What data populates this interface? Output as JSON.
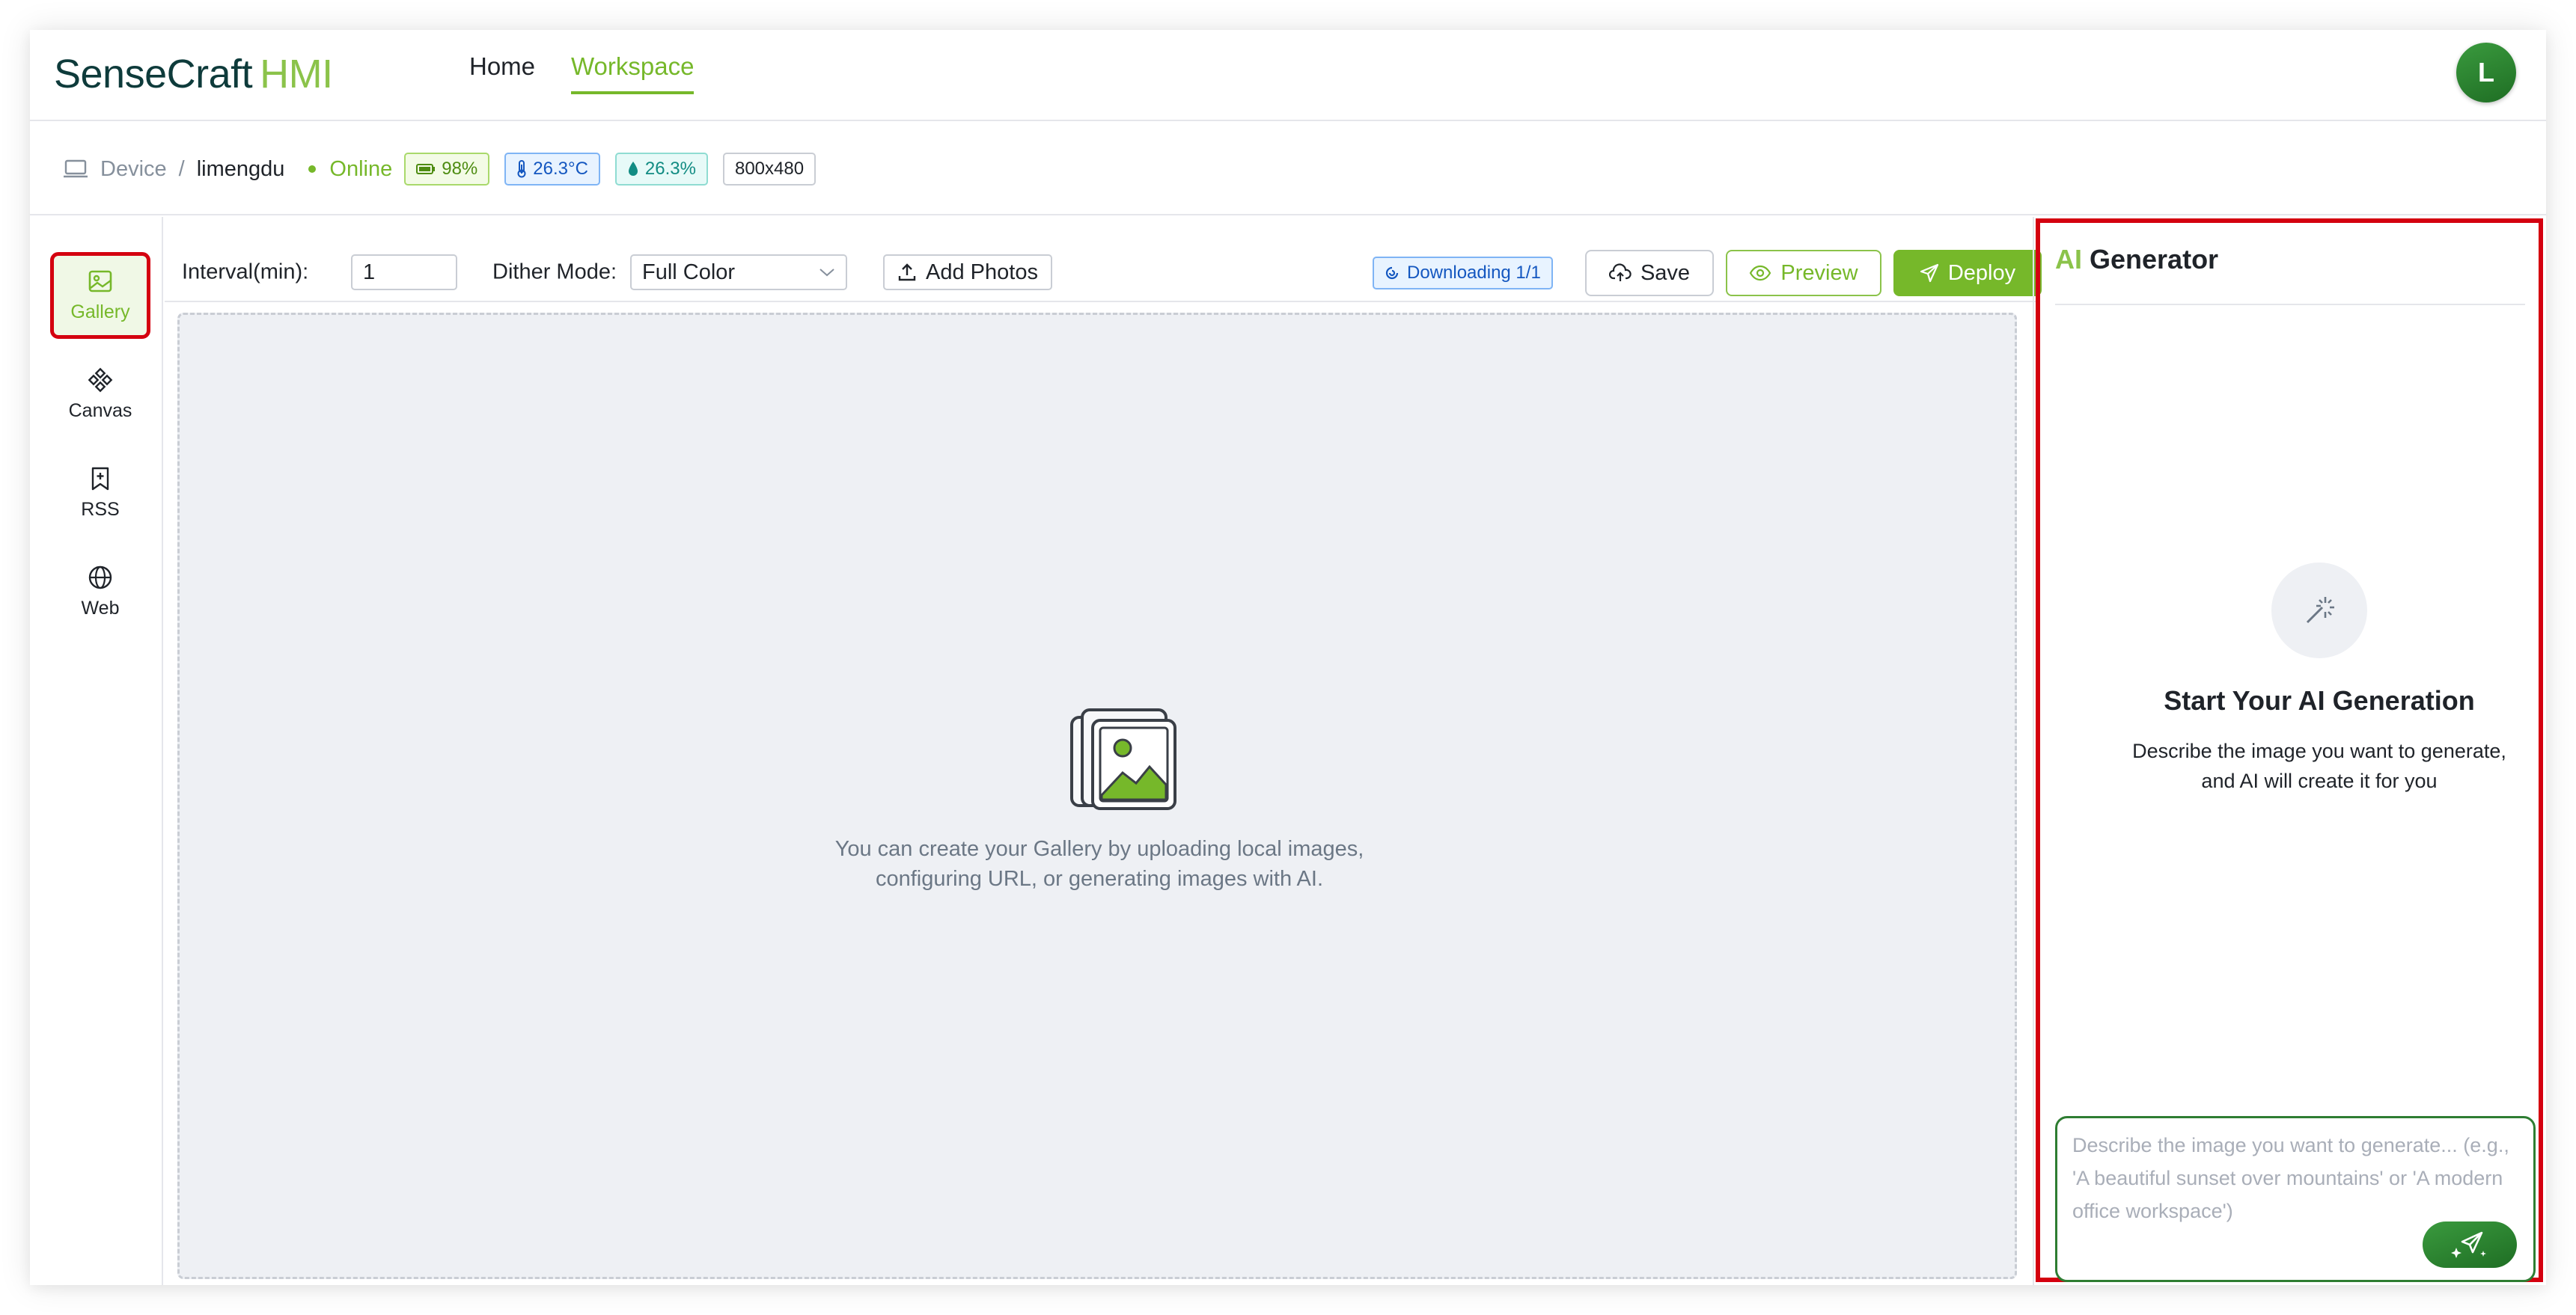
{
  "app": {
    "logo_part1": "SenseCraft",
    "logo_part2": "HMI"
  },
  "nav": {
    "home": "Home",
    "workspace": "Workspace",
    "avatar_initial": "L"
  },
  "breadcrumb": {
    "device": "Device",
    "separator": "/",
    "device_name": "limengdu",
    "status": "Online",
    "battery": "98%",
    "temperature": "26.3°C",
    "humidity": "26.3%",
    "resolution": "800x480"
  },
  "sidebar": {
    "items": [
      {
        "label": "Gallery",
        "icon": "image-icon",
        "active": true
      },
      {
        "label": "Canvas",
        "icon": "canvas-icon",
        "active": false
      },
      {
        "label": "RSS",
        "icon": "rss-icon",
        "active": false
      },
      {
        "label": "Web",
        "icon": "globe-icon",
        "active": false
      }
    ]
  },
  "toolbar": {
    "interval_label": "Interval(min):",
    "interval_value": "1",
    "dither_label": "Dither Mode:",
    "dither_value": "Full Color",
    "add_photos": "Add Photos",
    "downloading": "Downloading 1/1",
    "save": "Save",
    "preview": "Preview",
    "deploy": "Deploy"
  },
  "gallery": {
    "empty_line1": "You can create your Gallery by uploading local images,",
    "empty_line2": "configuring URL, or generating images with AI."
  },
  "ai_panel": {
    "title_prefix": "AI",
    "title_rest": "Generator",
    "heading": "Start Your AI Generation",
    "desc_line1": "Describe the image you want to generate,",
    "desc_line2": "and AI will create it for you",
    "placeholder": "Describe the image you want to generate... (e.g., 'A beautiful sunset over mountains' or 'A modern office workspace')"
  },
  "colors": {
    "brand_green": "#76b82a",
    "highlight_red": "#d4000f",
    "dark_green": "#2e7d32"
  }
}
